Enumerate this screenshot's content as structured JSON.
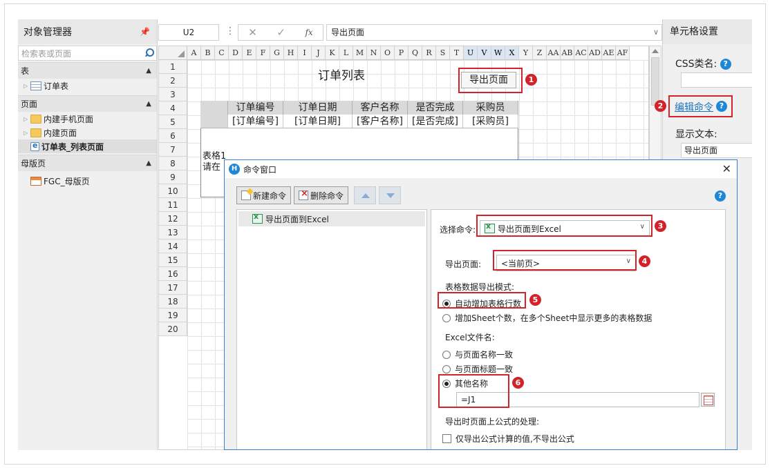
{
  "object_manager": {
    "title": "对象管理器",
    "search_placeholder": "检索表或页面",
    "sections": {
      "tables": {
        "label": "表",
        "items": [
          {
            "label": "订单表"
          }
        ]
      },
      "pages": {
        "label": "页面",
        "items": [
          {
            "label": "内建手机页面"
          },
          {
            "label": "内建页面"
          },
          {
            "label": "订单表_列表页面"
          }
        ]
      },
      "masters": {
        "label": "母版页",
        "items": [
          {
            "label": "FGC_母版页"
          }
        ]
      }
    }
  },
  "formula_bar": {
    "cell_ref": "U2",
    "cancel": "✕",
    "confirm": "✓",
    "fx": "fx",
    "value": "导出页面"
  },
  "grid": {
    "columns": [
      "A",
      "B",
      "C",
      "D",
      "E",
      "F",
      "G",
      "H",
      "I",
      "J",
      "K",
      "L",
      "M",
      "N",
      "O",
      "P",
      "Q",
      "R",
      "S",
      "T",
      "U",
      "V",
      "W",
      "X",
      "Y",
      "Z",
      "AA",
      "AB",
      "AC",
      "AD",
      "AE",
      "AF"
    ],
    "highlight_columns": [
      "U",
      "V",
      "W",
      "X"
    ],
    "rows": [
      "1",
      "2",
      "3",
      "4",
      "5",
      "6",
      "7",
      "8",
      "9",
      "10",
      "11",
      "12",
      "13",
      "14",
      "15",
      "16",
      "17",
      "18",
      "19",
      "20"
    ],
    "page_title": "订单列表",
    "export_button": "导出页面",
    "table_headers": [
      "订单编号",
      "订单日期",
      "客户名称",
      "是否完成",
      "采购员"
    ],
    "table_fields": [
      "[订单编号]",
      "[订单日期]",
      "[客户名称]",
      "[是否完成]",
      "[采购员]"
    ],
    "table_note_1": "表格1",
    "table_note_2": "请在"
  },
  "cell_settings": {
    "title": "单元格设置",
    "css_label": "CSS类名:",
    "edit_command": "编辑命令",
    "display_text_label": "显示文本:",
    "display_text_value": "导出页面"
  },
  "command_dialog": {
    "title": "命令窗口",
    "new_command": "新建命令",
    "delete_command": "删除命令",
    "commands": [
      {
        "label": "导出页面到Excel"
      }
    ],
    "select_command_label": "选择命令:",
    "select_command_value": "导出页面到Excel",
    "export_page_label": "导出页面:",
    "export_page_value": "<当前页>",
    "table_mode_label": "表格数据导出模式:",
    "mode_auto_rows": "自动增加表格行数",
    "mode_sheets": "增加Sheet个数，在多个Sheet中显示更多的表格数据",
    "filename_label": "Excel文件名:",
    "name_same_page": "与页面名称一致",
    "name_same_title": "与页面标题一致",
    "name_other": "其他名称",
    "other_name_value": "=J1",
    "formula_handling_label": "导出时页面上公式的处理:",
    "values_only": "仅导出公式计算的值,不导出公式"
  },
  "annotations": [
    "1",
    "2",
    "3",
    "4",
    "5",
    "6"
  ],
  "colors": {
    "accent": "#1e88d6",
    "annotation_red": "#d2232a"
  }
}
